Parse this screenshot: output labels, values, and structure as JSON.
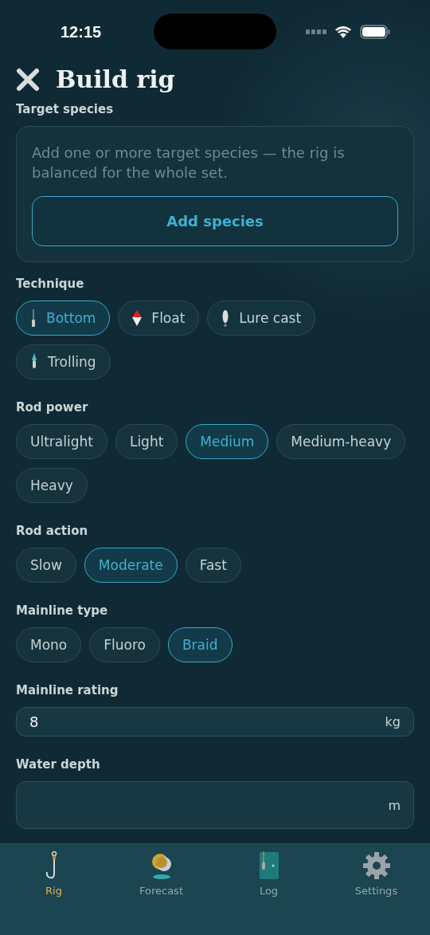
{
  "status_bar": {
    "time": "12:15"
  },
  "header": {
    "title": "Build rig"
  },
  "target_species": {
    "label": "Target species",
    "hint": "Add one or more target species — the rig is balanced for the whole set.",
    "button": "Add species"
  },
  "technique": {
    "label": "Technique",
    "options": [
      {
        "label": "Bottom",
        "selected": true
      },
      {
        "label": "Float",
        "selected": false
      },
      {
        "label": "Lure cast",
        "selected": false
      },
      {
        "label": "Trolling",
        "selected": false
      }
    ]
  },
  "rod_power": {
    "label": "Rod power",
    "options": [
      {
        "label": "Ultralight",
        "selected": false
      },
      {
        "label": "Light",
        "selected": false
      },
      {
        "label": "Medium",
        "selected": true
      },
      {
        "label": "Medium-heavy",
        "selected": false
      },
      {
        "label": "Heavy",
        "selected": false
      }
    ]
  },
  "rod_action": {
    "label": "Rod action",
    "options": [
      {
        "label": "Slow",
        "selected": false
      },
      {
        "label": "Moderate",
        "selected": true
      },
      {
        "label": "Fast",
        "selected": false
      }
    ]
  },
  "mainline_type": {
    "label": "Mainline type",
    "options": [
      {
        "label": "Mono",
        "selected": false
      },
      {
        "label": "Fluoro",
        "selected": false
      },
      {
        "label": "Braid",
        "selected": true
      }
    ]
  },
  "mainline_rating": {
    "label": "Mainline rating",
    "value": "8",
    "unit": "kg"
  },
  "water_depth": {
    "label": "Water depth",
    "unit": "m"
  },
  "tab_bar": [
    {
      "label": "Rig",
      "selected": true
    },
    {
      "label": "Forecast",
      "selected": false
    },
    {
      "label": "Log",
      "selected": false
    },
    {
      "label": "Settings",
      "selected": false
    }
  ]
}
